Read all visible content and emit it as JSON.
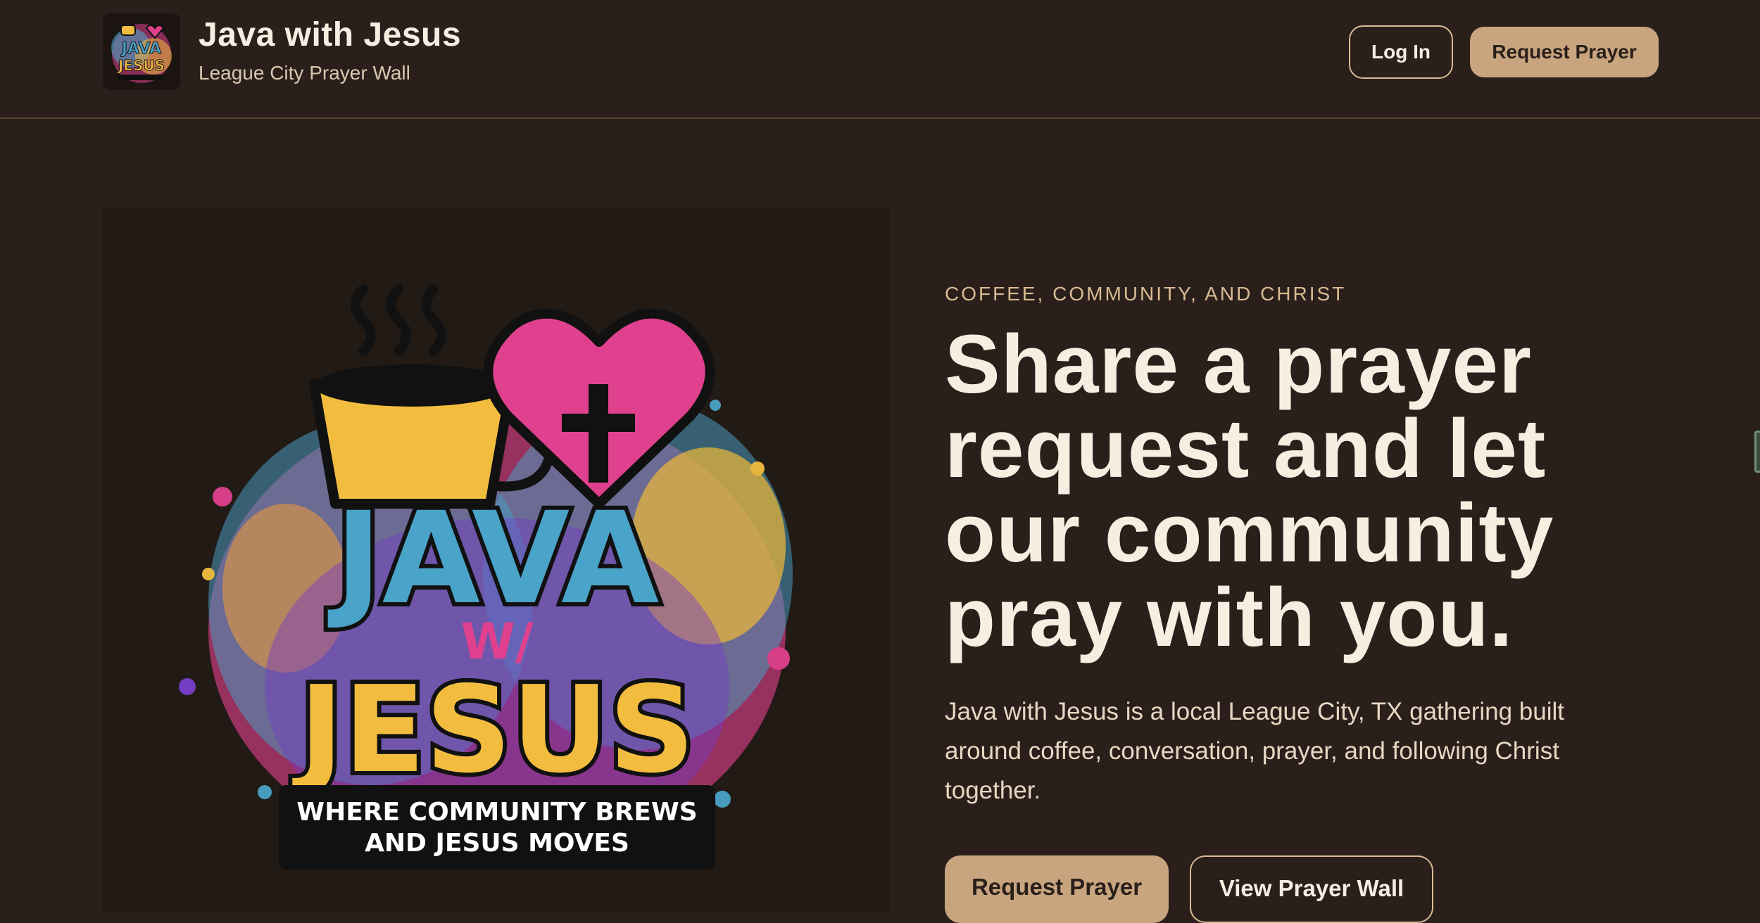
{
  "header": {
    "logo_text_top": "JAVA",
    "logo_text_bottom": "JESUS",
    "title": "Java with Jesus",
    "subtitle": "League City Prayer Wall",
    "login_label": "Log In",
    "request_label": "Request Prayer"
  },
  "hero_image": {
    "text_java": "JAVA",
    "text_with": "W/",
    "text_jesus": "JESUS",
    "tagline_line1": "WHERE COMMUNITY BREWS",
    "tagline_line2": "AND JESUS MOVES"
  },
  "hero": {
    "eyebrow": "COFFEE, COMMUNITY, AND CHRIST",
    "headline": "Share a prayer request and let our community pray with you.",
    "description": "Java with Jesus is a local League City, TX gathering built around coffee, conversation, prayer, and following Christ together.",
    "primary_cta": "Request Prayer",
    "secondary_cta": "View Prayer Wall"
  },
  "colors": {
    "background": "#2a1f1a",
    "accent": "#c8a57f",
    "text": "#f7eee2",
    "logo_blue": "#4aa3c8",
    "logo_yellow": "#f2bd3f",
    "logo_pink": "#e0418e"
  }
}
